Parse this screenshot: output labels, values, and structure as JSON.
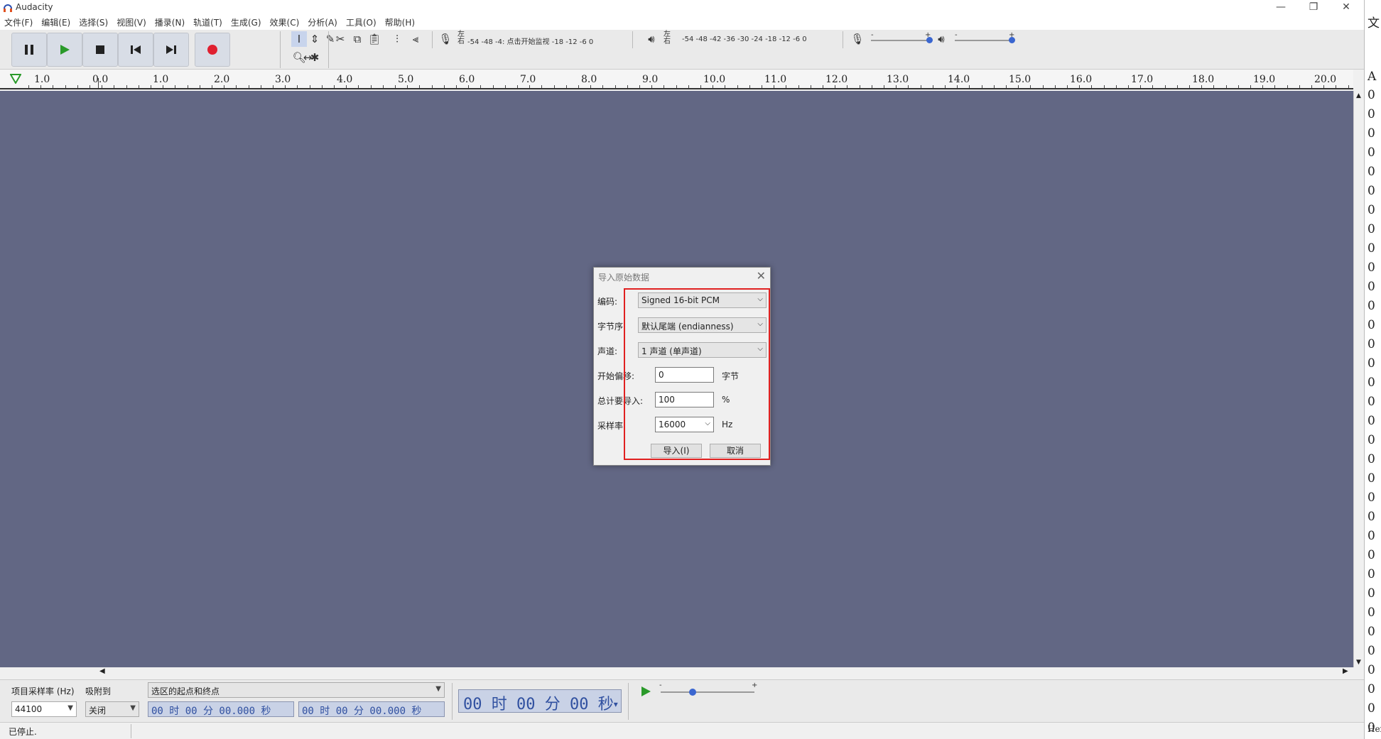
{
  "window": {
    "title": "Audacity"
  },
  "menu": [
    "文件(F)",
    "编辑(E)",
    "选择(S)",
    "视图(V)",
    "播录(N)",
    "轨道(T)",
    "生成(G)",
    "效果(C)",
    "分析(A)",
    "工具(O)",
    "帮助(H)"
  ],
  "toolbar": {
    "rec_meter_lr": "左\n右",
    "rec_meter_scale": "-54 -48 -4: 点击开始监视 -18 -12  -6  0",
    "play_meter_scale": "-54 -48 -42 -36 -30 -24 -18 -12  -6  0",
    "rec_slider_min": "-",
    "rec_slider_max": "+",
    "play_slider_min": "-",
    "play_slider_max": "+"
  },
  "ruler": [
    "1.0",
    "0.0",
    "1.0",
    "2.0",
    "3.0",
    "4.0",
    "5.0",
    "6.0",
    "7.0",
    "8.0",
    "9.0",
    "10.0",
    "11.0",
    "12.0",
    "13.0",
    "14.0",
    "15.0",
    "16.0",
    "17.0",
    "18.0",
    "19.0",
    "20.0"
  ],
  "dialog": {
    "title": "导入原始数据",
    "encoding_label": "编码:",
    "encoding_value": "Signed 16-bit PCM",
    "byteorder_label": "字节序",
    "byteorder_value": "默认尾端 (endianness)",
    "channels_label": "声道:",
    "channels_value": "1 声道 (单声道)",
    "offset_label": "开始偏移:",
    "offset_value": "0",
    "offset_unit": "字节",
    "amount_label": "总计要导入:",
    "amount_value": "100",
    "amount_unit": "%",
    "rate_label": "采样率",
    "rate_value": "16000",
    "rate_unit": "Hz",
    "import_button": "导入(I)",
    "cancel_button": "取消"
  },
  "bottom": {
    "rate_label": "项目采样率 (Hz)",
    "snap_label": "吸附到",
    "rate_value": "44100",
    "snap_value": "关闭",
    "selection_mode": "选区的起点和终点",
    "start_time": "00 时 00 分 00.000 秒",
    "end_time": "00 时 00 分 00.000 秒",
    "audio_position": "00 时 00 分 00 秒",
    "speed_min": "-",
    "speed_max": "+"
  },
  "status": {
    "text": "已停止."
  },
  "right_strip": {
    "top1": "文",
    "a": "A",
    "zeros": "0",
    "hex": "Hex"
  }
}
